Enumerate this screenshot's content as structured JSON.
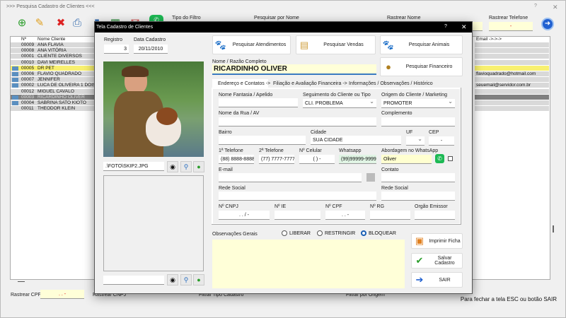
{
  "main_window": {
    "title": ">>> Pesquisa Cadastro de Clientes <<<",
    "help": "?",
    "close": "✕",
    "toolbar_icons": [
      "add-icon",
      "edit-icon",
      "delete-icon",
      "print-icon",
      "export-icon",
      "excel-icon",
      "email-icon",
      "whatsapp-icon"
    ],
    "filter_type_label": "Tipo do Filtro",
    "search_name_label": "Pesquisar por Nome",
    "track_name_label": "Rastrear Nome",
    "track_phone_label": "Rastrear Telefone",
    "track_phone_value": "-",
    "grid": {
      "col_num": "Nº",
      "col_name": "Nome Cliente",
      "col_email": "Email ->->->",
      "rows": [
        {
          "num": "00009",
          "name": "ANA FLAVIA",
          "email": "",
          "flag": false,
          "state": ""
        },
        {
          "num": "00008",
          "name": "ANA VITÓRIA",
          "email": "",
          "flag": false,
          "state": ""
        },
        {
          "num": "00001",
          "name": "CLIENTE DIVERSOS",
          "email": "",
          "flag": false,
          "state": ""
        },
        {
          "num": "00010",
          "name": "DAVI MEIRELLES",
          "email": "",
          "flag": false,
          "state": ""
        },
        {
          "num": "00005",
          "name": "DR PET",
          "email": "",
          "flag": true,
          "state": "highlight"
        },
        {
          "num": "00006",
          "name": "FLAVIO QUADRADO",
          "email": "flavioquadrado@hotmail.com",
          "flag": true,
          "state": ""
        },
        {
          "num": "00007",
          "name": "JENNIFER",
          "email": "",
          "flag": true,
          "state": ""
        },
        {
          "num": "00002",
          "name": "LUCA DE OLIVEIRA 1 DOIS",
          "email": "seuemail@servidor.com.br",
          "flag": true,
          "state": ""
        },
        {
          "num": "00012",
          "name": "MIGUEL CAVALO",
          "email": "",
          "flag": false,
          "state": ""
        },
        {
          "num": "00003",
          "name": "RICARDINHO OLIVER",
          "email": "",
          "flag": true,
          "state": "selected"
        },
        {
          "num": "00004",
          "name": "SABRINA SATO KIOTO",
          "email": "",
          "flag": true,
          "state": ""
        },
        {
          "num": "00011",
          "name": "THEODOR KLEIN",
          "email": "",
          "flag": false,
          "state": ""
        }
      ]
    },
    "track_cpf_label": "Rastrear CPF",
    "track_cpf_value": ". . -",
    "track_cnpj_label": "Rastrear CNPJ",
    "filter_type_reg_label": "Filtrar Tipo Cadastro",
    "filter_origin_label": "Filtrar por Origem",
    "close_hint": "Para fechar a tela ESC ou botão SAIR"
  },
  "dialog": {
    "title": "Tela Cadastro de Clientes",
    "help": "?",
    "close": "✕",
    "registro_label": "Registro",
    "registro": "3",
    "data_label": "Data Cadastro",
    "data": "20/11/2010",
    "photo_path": ".\\FOTO\\SKIP2.JPG",
    "btn_atendimentos": "Pesquisar  Atendimentos",
    "btn_vendas": "Pesquisar Vendas",
    "btn_animais": "Pesquisar Animais",
    "btn_financeiro": "Pesquisar  Financeiro",
    "nome_label": "Nome / Razão Completo",
    "nome": "RICARDINHO OLIVER",
    "tabs": [
      "Endereço e Contatos ->",
      "Filiação e Avaliação Financeira ->",
      "Informações / Observações / Histórico"
    ],
    "fields": {
      "fantasia_label": "Nome Fantasia / Apelido",
      "fantasia": "",
      "seguimento_label": "Seguimento do Cliente ou Tipo",
      "seguimento": "CLI. PROBLEMA",
      "origem_label": "Origem do Cliente / Marketing",
      "origem": "PROMOTER",
      "rua_label": "Nome da Rua / AV",
      "complemento_label": "Complemento",
      "bairro_label": "Bairro",
      "cidade_label": "Cidade",
      "cidade": "SUA CIDADE",
      "uf_label": "UF",
      "cep_label": "CEP",
      "cep": "-",
      "tel1_label": "1ª Telefone",
      "tel1": "(88) 8888-8888",
      "tel2_label": "2ª Telefone",
      "tel2": "(77) 7777-7777",
      "cel_label": "Nº Celular",
      "cel": "(  )    -",
      "whats_label": "Whatsapp",
      "whats": "(99)99999-9999",
      "abord_label": "Abordagem no WhatsApp",
      "abord": "Oliver",
      "email_label": "E-mail",
      "contato_label": "Contato",
      "rede1_label": "Rede Social",
      "rede2_label": "Rede Social",
      "cnpj_label": "Nº CNPJ",
      "cnpj": ".   .   /   -",
      "ie_label": "Nº IE",
      "cpf_label": "Nº CPF",
      "cpf": ".   .   -",
      "rg_label": "Nº RG",
      "orgao_label": "Orgão Emissor"
    },
    "obs_label": "Observações Gerais",
    "radios": [
      {
        "label": "LIBERAR",
        "checked": false
      },
      {
        "label": "RESTRINGIR",
        "checked": false
      },
      {
        "label": "BLOQUEAR",
        "checked": true
      }
    ],
    "btn_imprimir": "Imprimir Ficha",
    "btn_salvar": "Salvar Cadastro",
    "btn_sair": "SAIR"
  }
}
